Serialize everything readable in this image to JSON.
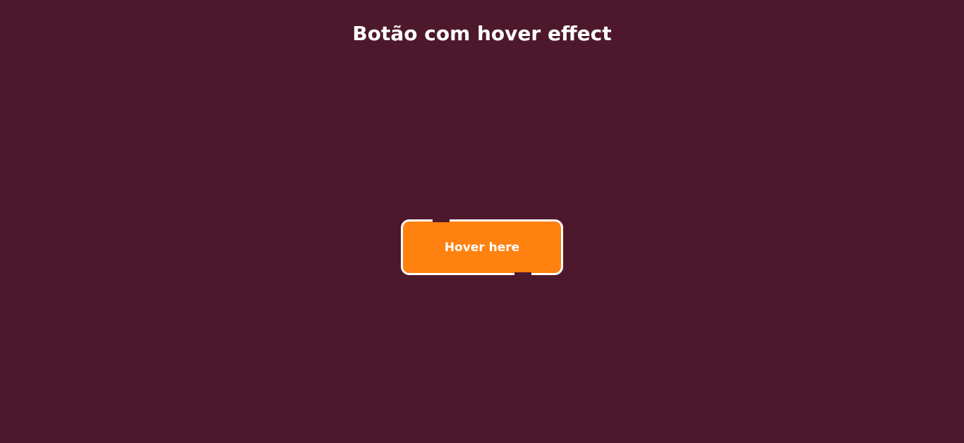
{
  "page": {
    "title": "Botão com hover effect"
  },
  "button": {
    "label": "Hover here"
  },
  "colors": {
    "background": "#4d182c",
    "button_fill": "#ff8110",
    "button_border": "#ffffff",
    "text": "#ffffff"
  }
}
